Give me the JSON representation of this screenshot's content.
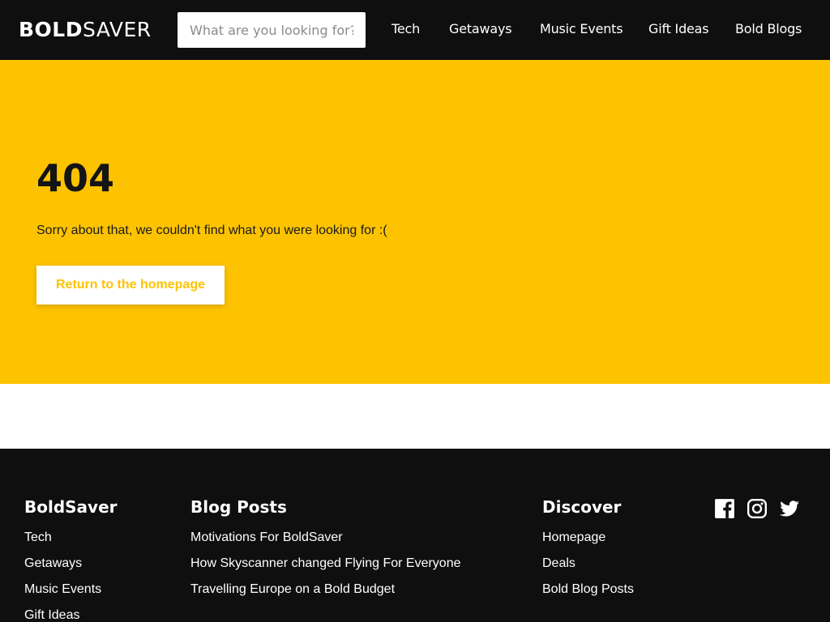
{
  "header": {
    "logo_bold": "BOLD",
    "logo_light": "SAVER",
    "search_placeholder": "What are you looking for?",
    "nav": [
      "Tech",
      "Getaways",
      "Music Events",
      "Gift Ideas",
      "Bold Blogs"
    ]
  },
  "hero": {
    "code": "404",
    "message": "Sorry about that, we couldn't find what you were looking for :(",
    "button_label": "Return to the homepage"
  },
  "footer": {
    "columns": [
      {
        "title": "BoldSaver",
        "links": [
          "Tech",
          "Getaways",
          "Music Events",
          "Gift Ideas"
        ]
      },
      {
        "title": "Blog Posts",
        "links": [
          "Motivations For BoldSaver",
          "How Skyscanner changed Flying For Everyone",
          "Travelling Europe on a Bold Budget"
        ]
      },
      {
        "title": "Discover",
        "links": [
          "Homepage",
          "Deals",
          "Bold Blog Posts"
        ]
      }
    ],
    "social_icons": [
      "facebook-icon",
      "instagram-icon",
      "twitter-icon"
    ]
  },
  "colors": {
    "brand_yellow": "#fdc300",
    "dark": "#0f0f0f",
    "white": "#ffffff"
  }
}
